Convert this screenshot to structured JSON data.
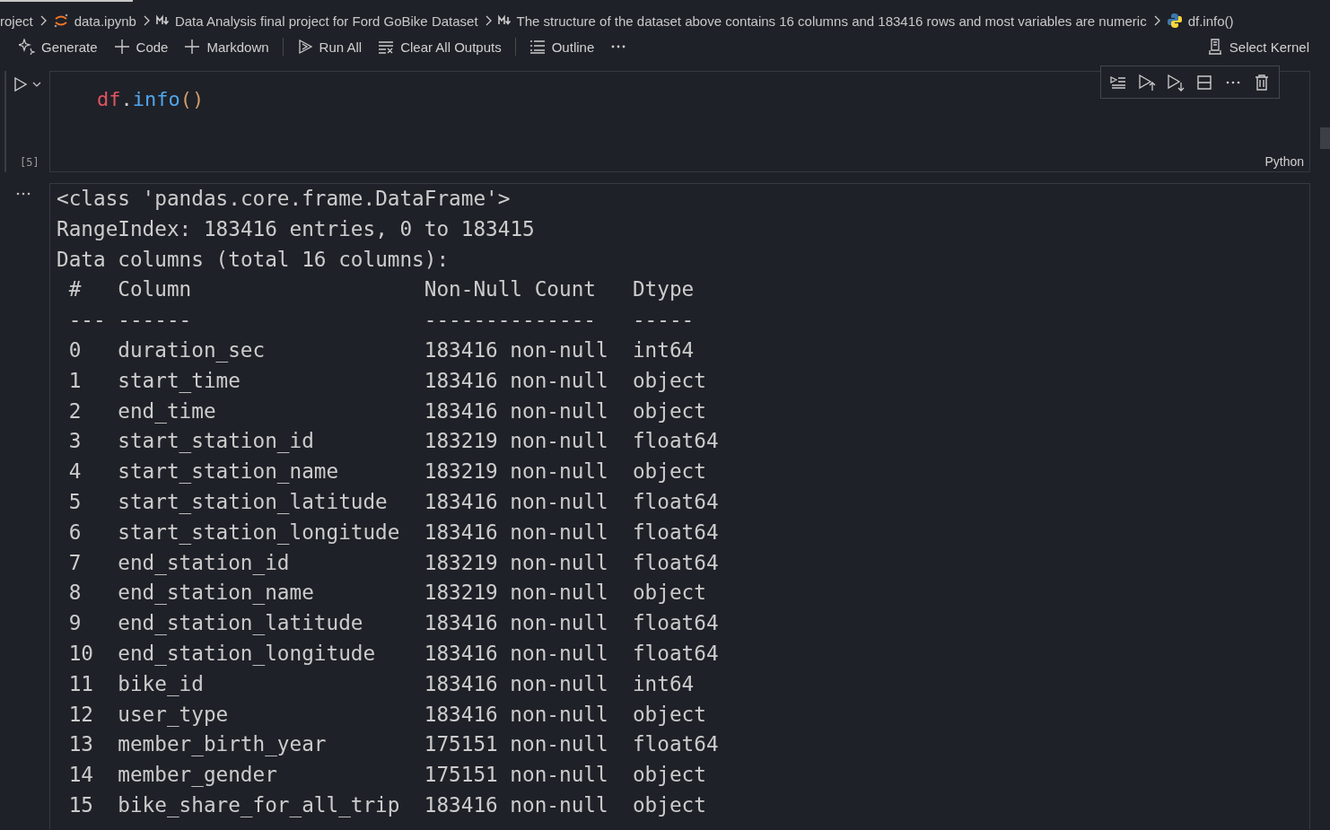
{
  "breadcrumbs": [
    {
      "kind": "text",
      "label": "roject"
    },
    {
      "kind": "notebook",
      "label": "data.ipynb"
    },
    {
      "kind": "markdown",
      "label": "Data Analysis final project for Ford GoBike Dataset"
    },
    {
      "kind": "markdown",
      "label": "The structure of the dataset above contains 16 columns and 183416 rows and most variables are numeric"
    },
    {
      "kind": "python",
      "label": "df.info()"
    }
  ],
  "toolbar": [
    {
      "kind": "sparkle",
      "label": "Generate"
    },
    {
      "kind": "plus",
      "label": "Code"
    },
    {
      "kind": "plus",
      "label": "Markdown"
    },
    {
      "kind": "sep"
    },
    {
      "kind": "run",
      "label": "Run All"
    },
    {
      "kind": "clear",
      "label": "Clear All Outputs"
    },
    {
      "kind": "sep"
    },
    {
      "kind": "outline",
      "label": "Outline"
    },
    {
      "kind": "more"
    }
  ],
  "kernel": {
    "label": "Select Kernel"
  },
  "cell": {
    "code": [
      {
        "kind": "var",
        "text": "df"
      },
      {
        "kind": "punct",
        "text": "."
      },
      {
        "kind": "func",
        "text": "info"
      },
      {
        "kind": "paren",
        "text": "()"
      }
    ],
    "execution_count": "[5]",
    "language": "Python"
  },
  "output": {
    "lines": [
      "<class 'pandas.core.frame.DataFrame'>",
      "RangeIndex: 183416 entries, 0 to 183415",
      "Data columns (total 16 columns):"
    ],
    "header": [
      "#",
      "Column",
      "Non-Null Count",
      "Dtype"
    ],
    "rule": [
      "---",
      "------",
      "--------------",
      "-----"
    ],
    "rows": [
      [
        "0",
        "duration_sec",
        "183416 non-null",
        "int64"
      ],
      [
        "1",
        "start_time",
        "183416 non-null",
        "object"
      ],
      [
        "2",
        "end_time",
        "183416 non-null",
        "object"
      ],
      [
        "3",
        "start_station_id",
        "183219 non-null",
        "float64"
      ],
      [
        "4",
        "start_station_name",
        "183219 non-null",
        "object"
      ],
      [
        "5",
        "start_station_latitude",
        "183416 non-null",
        "float64"
      ],
      [
        "6",
        "start_station_longitude",
        "183416 non-null",
        "float64"
      ],
      [
        "7",
        "end_station_id",
        "183219 non-null",
        "float64"
      ],
      [
        "8",
        "end_station_name",
        "183219 non-null",
        "object"
      ],
      [
        "9",
        "end_station_latitude",
        "183416 non-null",
        "float64"
      ],
      [
        "10",
        "end_station_longitude",
        "183416 non-null",
        "float64"
      ],
      [
        "11",
        "bike_id",
        "183416 non-null",
        "int64"
      ],
      [
        "12",
        "user_type",
        "183416 non-null",
        "object"
      ],
      [
        "13",
        "member_birth_year",
        "175151 non-null",
        "float64"
      ],
      [
        "14",
        "member_gender",
        "175151 non-null",
        "object"
      ],
      [
        "15",
        "bike_share_for_all_trip",
        "183416 non-null",
        "object"
      ]
    ]
  }
}
